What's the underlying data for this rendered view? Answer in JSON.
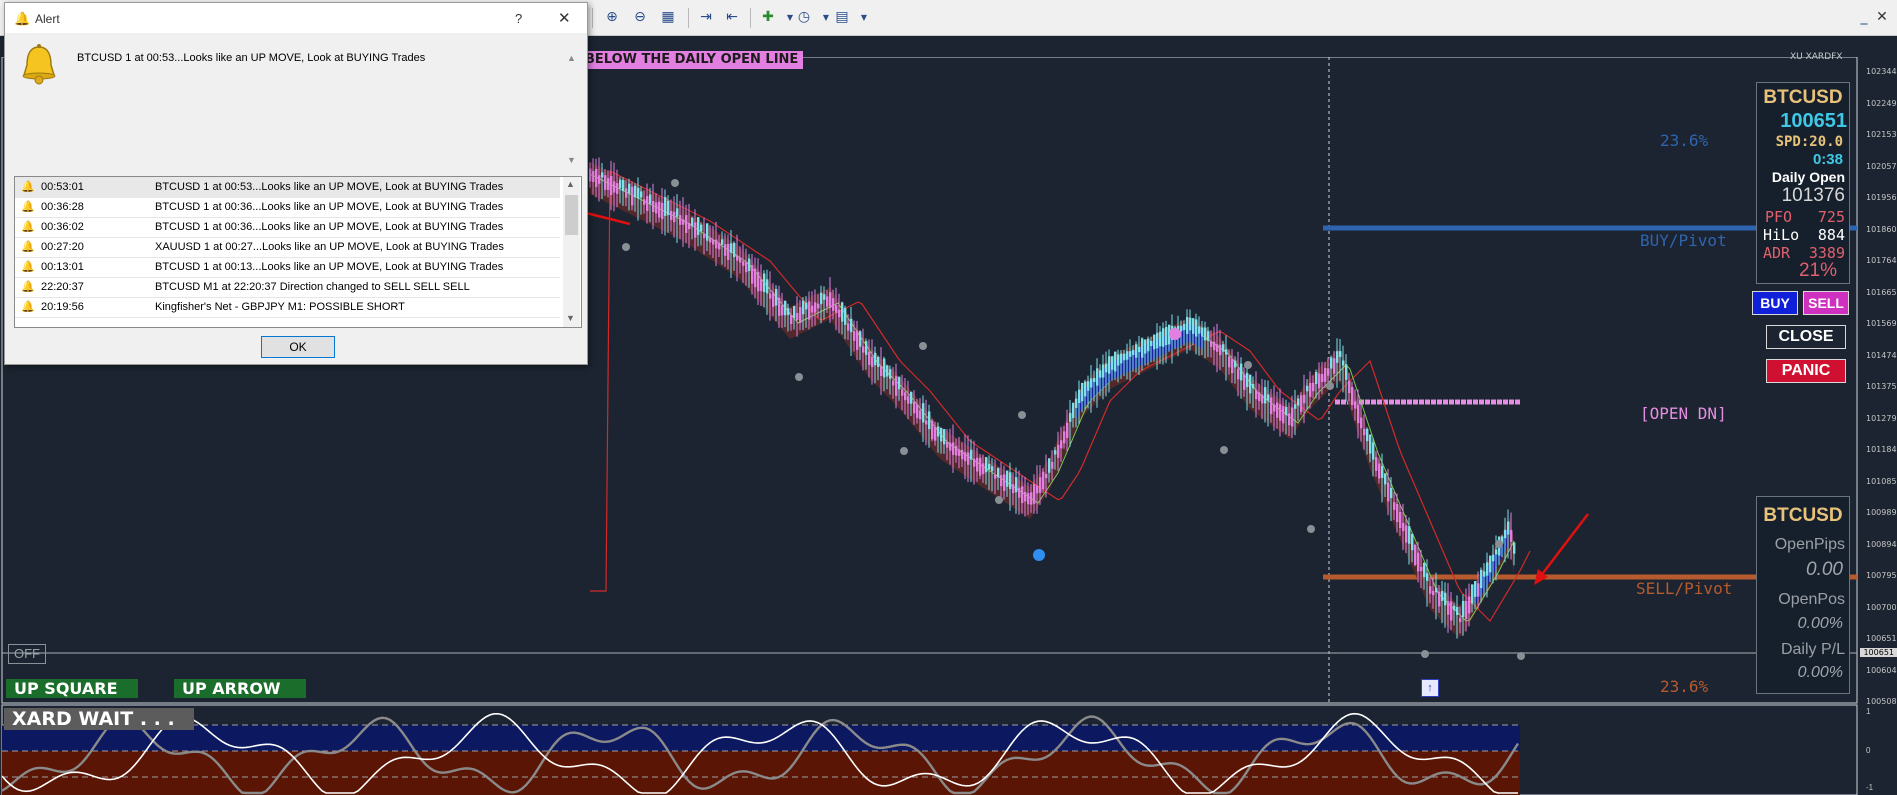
{
  "toolbar": {
    "icons": [
      "zoom-in-icon",
      "zoom-out-icon",
      "tile-windows-icon",
      "auto-scroll-icon",
      "chart-shift-icon",
      "indicators-icon",
      "periodicity-icon",
      "templates-icon"
    ]
  },
  "banner": "BELOW THE DAILY OPEN LINE",
  "brand": "XU XARDFX",
  "levels": {
    "fib_top": "23.6%",
    "buy_pivot": "BUY/Pivot",
    "open_dn": "[OPEN DN]",
    "sell_pivot": "SELL/Pivot",
    "fib_bottom": "23.6%"
  },
  "info_panel": {
    "symbol": "BTCUSD",
    "price": "100651",
    "spread": "SPD:20.0",
    "timer": "0:38",
    "daily_open_label": "Daily Open",
    "daily_open_value": "101376",
    "pfo_label": "PFO",
    "pfo_value": "725",
    "hilo_label": "HiLo",
    "hilo_value": "884",
    "adr_label": "ADR",
    "adr_value": "3389",
    "adr_percent": "21%"
  },
  "trade_buttons": {
    "buy": "BUY",
    "sell": "SELL",
    "close": "CLOSE",
    "panic": "PANIC"
  },
  "position_panel": {
    "symbol": "BTCUSD",
    "open_pips_label": "OpenPips",
    "open_pips_value": "0.00",
    "open_pos_label": "OpenPos",
    "open_pos_value": "0.00%",
    "daily_pl_label": "Daily P/L",
    "daily_pl_value": "0.00%"
  },
  "price_axis": [
    "102344",
    "102249",
    "102153",
    "102057",
    "101956",
    "101860",
    "101764",
    "101665",
    "101569",
    "101474",
    "101375",
    "101279",
    "101184",
    "101085",
    "100989",
    "100894",
    "100795",
    "100700",
    "100651",
    "100604",
    "100508"
  ],
  "indicator_axis": [
    "1",
    "0",
    "-1"
  ],
  "off_button": "OFF",
  "signal_labels": {
    "up_square": "UP SQUARE",
    "up_arrow": "UP ARROW"
  },
  "indicator_title": "XARD WAIT . . .",
  "alert": {
    "title": "Alert",
    "help": "?",
    "close": "✕",
    "message": "BTCUSD  1 at 00:53...Looks like an UP MOVE, Look at BUYING Trades",
    "ok": "OK",
    "rows": [
      {
        "time": "00:53:01",
        "msg": "BTCUSD  1 at 00:53...Looks like an UP MOVE, Look at BUYING Trades"
      },
      {
        "time": "00:36:28",
        "msg": "BTCUSD  1 at 00:36...Looks like an UP MOVE, Look at BUYING Trades"
      },
      {
        "time": "00:36:02",
        "msg": "BTCUSD  1 at 00:36...Looks like an UP MOVE, Look at BUYING Trades"
      },
      {
        "time": "00:27:20",
        "msg": "XAUUSD  1 at 00:27...Looks like an UP MOVE, Look at BUYING Trades"
      },
      {
        "time": "00:13:01",
        "msg": "BTCUSD  1 at 00:13...Looks like an UP MOVE, Look at BUYING Trades"
      },
      {
        "time": "22:20:37",
        "msg": "BTCUSD M1 at 22:20:37 Direction changed to SELL SELL SELL"
      },
      {
        "time": "20:19:56",
        "msg": "Kingfisher's Net - GBPJPY M1: POSSIBLE SHORT"
      }
    ]
  },
  "colors": {
    "chart_bg": "#1b2430",
    "bull_candle": "#7ee0e8",
    "bear_candle": "#e27fe0",
    "buy_pivot": "#2f64b0",
    "sell_pivot": "#b75a2e",
    "open_dn": "#e58de0",
    "panel_text_gold": "#e8c27a",
    "panel_text_cyan": "#3ec8e6"
  }
}
